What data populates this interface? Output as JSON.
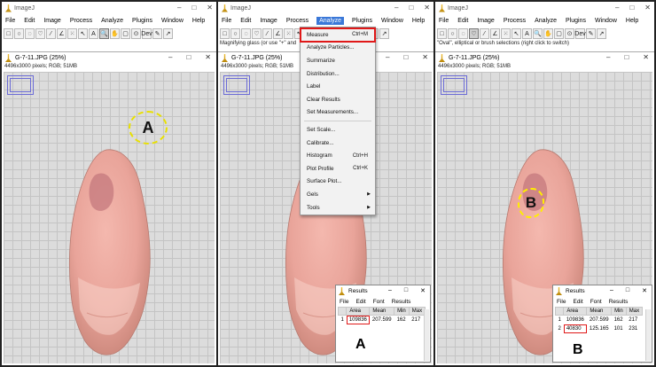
{
  "app": {
    "title": "ImageJ",
    "menus": [
      "File",
      "Edit",
      "Image",
      "Process",
      "Analyze",
      "Plugins",
      "Window",
      "Help"
    ],
    "win_controls": [
      "–",
      "□",
      "✕"
    ]
  },
  "panels": [
    {
      "status": "",
      "pressed_tool": 9,
      "image_title": "G-7-11.JPG (25%)",
      "image_info": "4496x3000 pixels; RGB; 51MB",
      "roi_label": "A"
    },
    {
      "status": "Magnifying glass (or use \"+\" and",
      "pressed_tool": 9,
      "image_title": "G-7-11.JPG (25%)",
      "image_info": "4496x3000 pixels; RGB; 51MB"
    },
    {
      "status": "\"Oval\", elliptical or brush selections (right click to switch)",
      "pressed_tool": 3,
      "image_title": "G-7-11.JPG (25%)",
      "image_info": "4496x3000 pixels; RGB; 51MB",
      "roi_label": "B"
    }
  ],
  "tool_icons": [
    "□",
    "○",
    "◌",
    "♡",
    "⁄",
    "∠",
    "⁙",
    "↖",
    "A",
    "🔍",
    "✋",
    "▢",
    "⊙",
    "Dev",
    "✎",
    "↗"
  ],
  "analyze_menu": {
    "items": [
      {
        "label": "Measure",
        "shortcut": "Ctrl+M"
      },
      {
        "label": "Analyze Particles..."
      },
      {
        "label": "Summarize"
      },
      {
        "label": "Distribution..."
      },
      {
        "label": "Label"
      },
      {
        "label": "Clear Results"
      },
      {
        "label": "Set Measurements..."
      },
      {
        "label": "Set Scale..."
      },
      {
        "label": "Calibrate..."
      },
      {
        "label": "Histogram",
        "shortcut": "Ctrl+H"
      },
      {
        "label": "Plot Profile",
        "shortcut": "Ctrl+K"
      },
      {
        "label": "Surface Plot..."
      },
      {
        "label": "Gels",
        "arrow": "▶"
      },
      {
        "label": "Tools",
        "arrow": "▶"
      }
    ]
  },
  "results_window": {
    "title": "Results",
    "menu": [
      "File",
      "Edit",
      "Font",
      "Results"
    ],
    "columns": [
      "",
      "Area",
      "Mean",
      "Min",
      "Max"
    ],
    "rows_first": [
      [
        "1",
        "109836",
        "207.599",
        "162",
        "217"
      ]
    ],
    "rows_second": [
      [
        "1",
        "109836",
        "207.599",
        "162",
        "217"
      ],
      [
        "2",
        "40830",
        "125.165",
        "101",
        "231"
      ]
    ],
    "label_first": "A",
    "label_second": "B"
  },
  "colors": {
    "roi_yellow": "#e8e000",
    "highlight_red": "#e01818",
    "menu_active": "#3a78d8"
  }
}
